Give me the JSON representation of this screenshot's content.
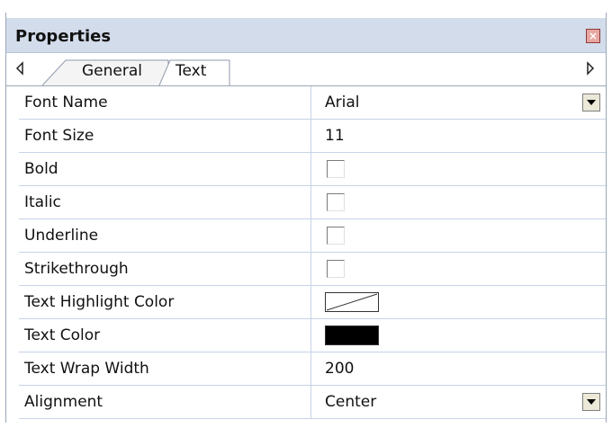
{
  "panel": {
    "title": "Properties"
  },
  "tabs": [
    {
      "label": "General",
      "active": false
    },
    {
      "label": "Text",
      "active": true
    }
  ],
  "properties": [
    {
      "name": "Font Name",
      "value": "Arial",
      "kind": "dropdown"
    },
    {
      "name": "Font Size",
      "value": "11",
      "kind": "text"
    },
    {
      "name": "Bold",
      "checked": false,
      "kind": "checkbox"
    },
    {
      "name": "Italic",
      "checked": false,
      "kind": "checkbox"
    },
    {
      "name": "Underline",
      "checked": false,
      "kind": "checkbox"
    },
    {
      "name": "Strikethrough",
      "checked": false,
      "kind": "checkbox"
    },
    {
      "name": "Text Highlight Color",
      "color": "none",
      "kind": "color"
    },
    {
      "name": "Text Color",
      "color": "#000000",
      "kind": "color"
    },
    {
      "name": "Text Wrap Width",
      "value": "200",
      "kind": "text"
    },
    {
      "name": "Alignment",
      "value": "Center",
      "kind": "dropdown"
    }
  ],
  "colors": {
    "titlebar_bg": "#d3dcea",
    "grid_line": "#c6d3e6",
    "close_button": "#e8a6a0"
  },
  "icons": {
    "close": "close-icon",
    "scroll_left": "chevron-left-icon",
    "scroll_right": "chevron-right-icon",
    "dropdown": "chevron-down-icon"
  }
}
